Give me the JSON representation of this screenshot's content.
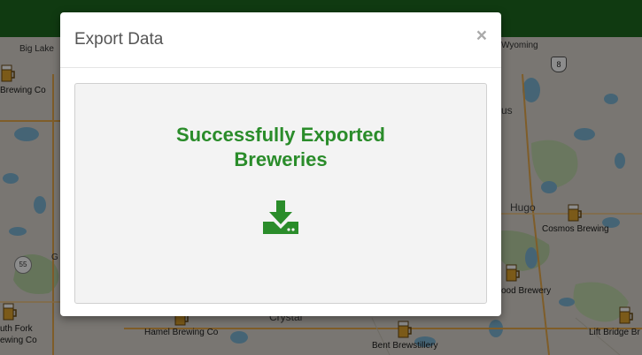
{
  "map": {
    "labels": [
      {
        "id": "big-lake",
        "text": "Big Lake"
      },
      {
        "id": "wyoming",
        "text": "Wyoming"
      },
      {
        "id": "hugo",
        "text": "Hugo"
      },
      {
        "id": "crystal",
        "text": "Crystal"
      },
      {
        "id": "us",
        "text": "us"
      },
      {
        "id": "g",
        "text": "G"
      }
    ],
    "breweries": [
      {
        "id": "brewing-co-left",
        "text": "Brewing Co"
      },
      {
        "id": "cosmos",
        "text": "Cosmos Brewing"
      },
      {
        "id": "wood",
        "text": "ood Brewery"
      },
      {
        "id": "hamel",
        "text": "Hamel Brewing Co"
      },
      {
        "id": "bent",
        "text": "Bent Brewstillery"
      },
      {
        "id": "lift-bridge",
        "text": "Lift Bridge Br"
      },
      {
        "id": "south-fork-1",
        "text": "uth Fork"
      },
      {
        "id": "south-fork-2",
        "text": "ewing Co"
      }
    ],
    "shields": [
      {
        "id": "hwy-8",
        "text": "8"
      },
      {
        "id": "hwy-55",
        "text": "55"
      }
    ]
  },
  "modal": {
    "title": "Export Data",
    "close_glyph": "×",
    "success_message_line1": "Successfully Exported",
    "success_message_line2": "Breweries",
    "download_icon": "download-icon",
    "accent_color": "#2a8c2a"
  }
}
